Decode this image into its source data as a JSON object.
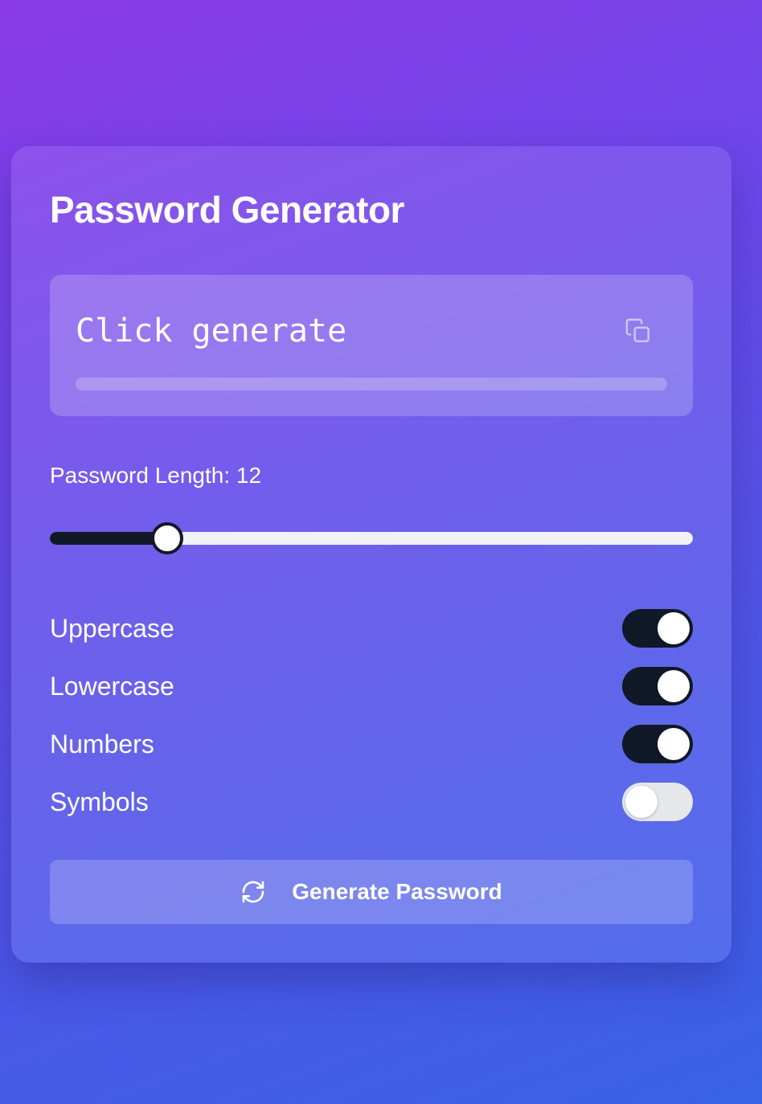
{
  "app": {
    "title": "Password Generator"
  },
  "password_display": {
    "text": "Click generate",
    "copy_icon": "copy-icon",
    "strength_fraction": 0
  },
  "length": {
    "label": "Password Length: 12",
    "value": 12,
    "fill_fraction": 0.18
  },
  "options": [
    {
      "label": "Uppercase",
      "enabled": true
    },
    {
      "label": "Lowercase",
      "enabled": true
    },
    {
      "label": "Numbers",
      "enabled": true
    },
    {
      "label": "Symbols",
      "enabled": false
    }
  ],
  "generate_button": {
    "label": "Generate Password",
    "icon": "refresh-icon"
  },
  "colors": {
    "toggle_on": "#111827",
    "toggle_off": "#e5e7eb",
    "slider_track": "#f1f2f7"
  }
}
